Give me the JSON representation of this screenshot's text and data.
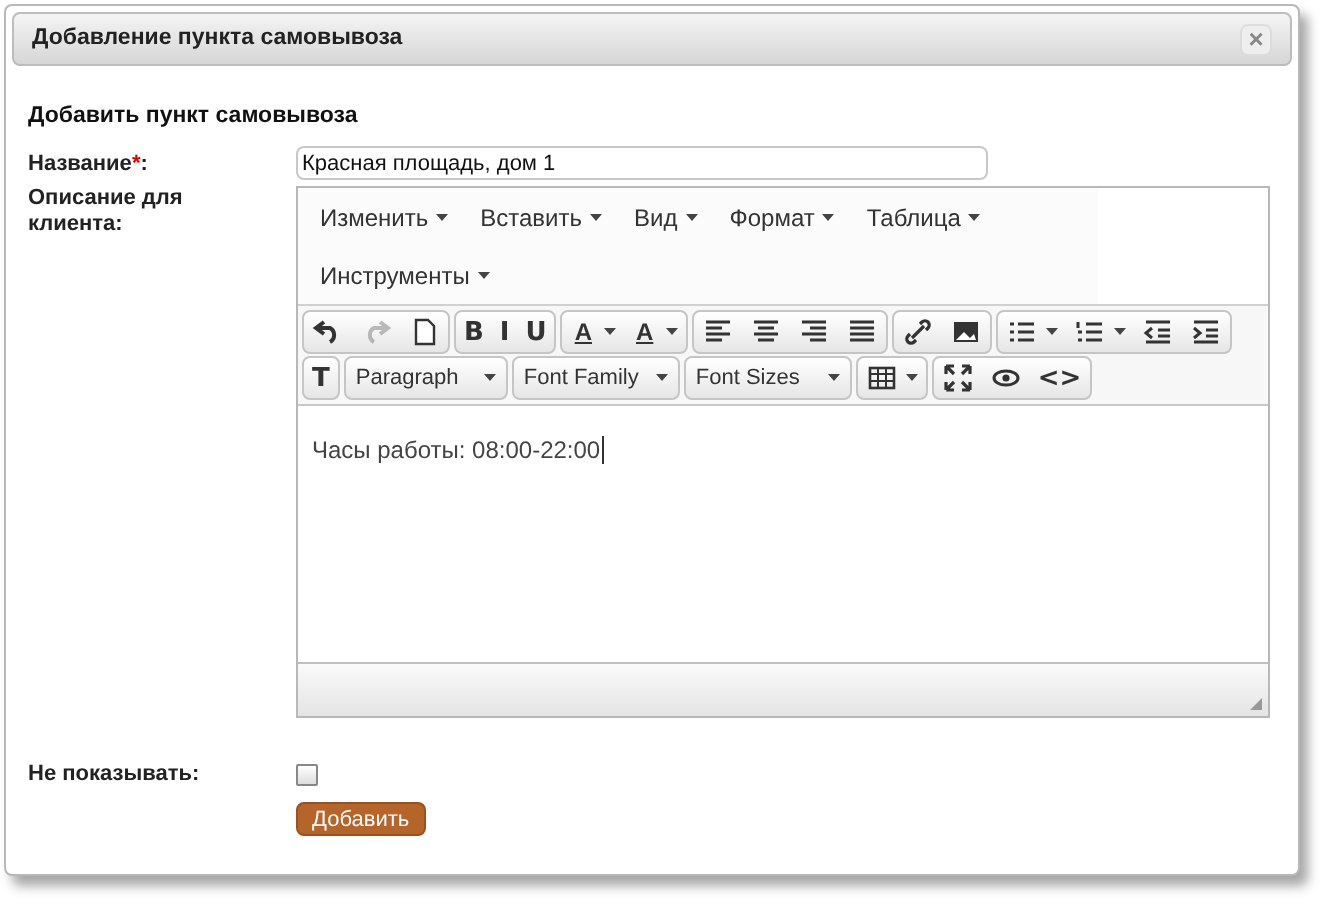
{
  "window": {
    "title": "Добавление пункта самовывоза",
    "close_glyph": "×"
  },
  "heading": "Добавить пункт самовывоза",
  "fields": [
    {
      "label": "Название",
      "required_mark": "*",
      "suffix": ":",
      "value": "Красная площадь, дом 1"
    }
  ],
  "editor": {
    "label": "Описание для клиента:",
    "menus": [
      {
        "label": "Изменить"
      },
      {
        "label": "Вставить"
      },
      {
        "label": "Вид"
      },
      {
        "label": "Формат"
      },
      {
        "label": "Таблица"
      },
      {
        "label": "Инструменты"
      }
    ],
    "toolbar_rows": [
      [
        [
          {
            "kind": "icon"
          },
          {
            "kind": "icon",
            "disabled": true
          },
          {
            "kind": "icon"
          }
        ],
        [
          {
            "kind": "glyph",
            "text": "B"
          },
          {
            "kind": "glyph",
            "text": "I"
          },
          {
            "kind": "glyph",
            "text": "U"
          }
        ],
        [
          {
            "kind": "split",
            "text": "A"
          },
          {
            "kind": "split",
            "text": "A"
          }
        ],
        [
          {
            "kind": "icon"
          },
          {
            "kind": "icon"
          },
          {
            "kind": "icon"
          },
          {
            "kind": "icon"
          }
        ],
        [
          {
            "kind": "icon"
          },
          {
            "kind": "icon"
          }
        ],
        [
          {
            "kind": "split_icon"
          },
          {
            "kind": "split_icon"
          },
          {
            "kind": "icon"
          },
          {
            "kind": "icon"
          }
        ]
      ],
      [
        [
          {
            "kind": "glyph",
            "text": "T"
          }
        ],
        [
          {
            "kind": "select",
            "label": "Paragraph"
          }
        ],
        [
          {
            "kind": "select",
            "label": "Font Family"
          }
        ],
        [
          {
            "kind": "select",
            "label": "Font Sizes"
          }
        ],
        [
          {
            "kind": "split_icon"
          }
        ],
        [
          {
            "kind": "icon"
          },
          {
            "kind": "icon"
          },
          {
            "kind": "glyph",
            "text": "<>"
          }
        ]
      ]
    ],
    "content": "Часы работы: 08:00-22:00"
  },
  "hidden": {
    "label": "Не показывать:",
    "checked": false
  },
  "submit": "Добавить"
}
